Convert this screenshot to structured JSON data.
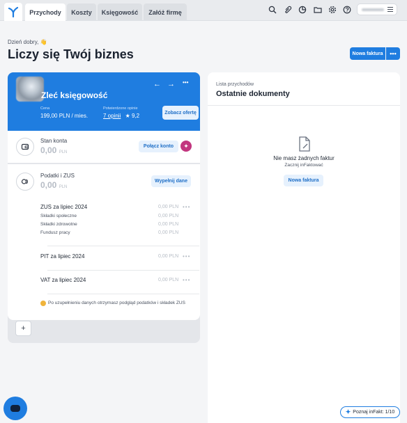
{
  "tabs": [
    {
      "label": "Przychody",
      "active": true
    },
    {
      "label": "Koszty",
      "active": false
    },
    {
      "label": "Księgowość",
      "active": false
    },
    {
      "label": "Załóż firmę",
      "active": false
    }
  ],
  "toolbar_icons": [
    "search-icon",
    "paperclip-icon",
    "chart-icon",
    "folder-icon",
    "settings-icon",
    "help-icon"
  ],
  "header": {
    "greeting": "Dzień dobry, 👋",
    "title": "Liczy się Twój biznes",
    "new_invoice_label": "Nowa faktura",
    "more_label": "•••"
  },
  "hero": {
    "title": "Zleć księgowość",
    "price_label": "Cena",
    "price_value": "199,00 PLN / mies.",
    "opinions_label": "Potwierdzone opinie",
    "opinions_link": "7 opinii",
    "rating": "★ 9,2",
    "offer_button": "Zobacz ofertę",
    "prev_arrow": "←",
    "next_arrow": "→",
    "more": "•••"
  },
  "account": {
    "label": "Stan konta",
    "amount": "0,00",
    "currency": "PLN",
    "connect_button": "Połącz konto"
  },
  "taxes": {
    "label": "Podatki i ZUS",
    "amount": "0,00",
    "currency": "PLN",
    "fill_button": "Wypełnij dane",
    "rows": [
      {
        "title": "ZUS za lipiec 2024",
        "amount": "0,00 PLN"
      },
      {
        "title": "PIT za lipiec 2024",
        "amount": "0,00 PLN"
      },
      {
        "title": "VAT za lipiec 2024",
        "amount": "0,00 PLN"
      }
    ],
    "zus_items": [
      {
        "title": "Składki społeczne",
        "amount": "0,00 PLN"
      },
      {
        "title": "Składki zdrowotne",
        "amount": "0,00 PLN"
      },
      {
        "title": "Fundusz pracy",
        "amount": "0,00 PLN"
      }
    ],
    "note": "Po uzupełnieniu danych otrzymasz podgląd podatków i składek ZUS",
    "row_more": "•••"
  },
  "add_label": "+",
  "documents": {
    "small_title": "Lista przychodów",
    "title": "Ostatnie dokumenty",
    "empty_title": "Nie masz żadnych faktur",
    "empty_sub": "Zacznij inFaktować",
    "empty_button": "Nowa faktura"
  },
  "tour": {
    "label": "Poznaj inFakt: 1/10"
  },
  "colors": {
    "accent": "#1f7de0",
    "pink": "#c2367f",
    "warning": "#f0b43c"
  }
}
